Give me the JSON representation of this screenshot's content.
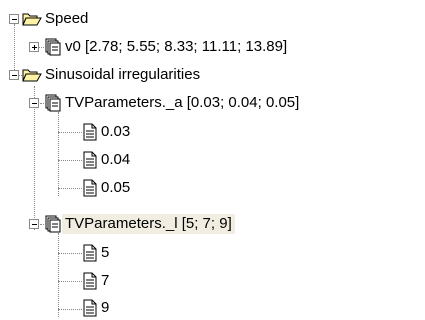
{
  "tree": {
    "speed": {
      "label": "Speed",
      "children": [
        {
          "label": "v0 [2.78; 5.55; 8.33; 11.11; 13.89]"
        }
      ]
    },
    "sinusoidal": {
      "label": "Sinusoidal irregularities",
      "tv_a": {
        "label": "TVParameters._a [0.03; 0.04; 0.05]",
        "children": [
          "0.03",
          "0.04",
          "0.05"
        ]
      },
      "tv_l": {
        "label": "TVParameters._l [5; 7; 9]",
        "children": [
          "5",
          "7",
          "9"
        ]
      }
    }
  },
  "colors": {
    "folder_fill": "#fdf2a6",
    "folder_stroke": "#000000",
    "selection_bg": "#f1eee1",
    "tree_lines": "#8a8a8a"
  },
  "icons": {
    "expander_collapse": "minus-box-icon",
    "expander_expand": "plus-box-icon",
    "folder": "open-folder-icon",
    "parameter": "stacked-pages-icon",
    "value": "document-icon"
  }
}
